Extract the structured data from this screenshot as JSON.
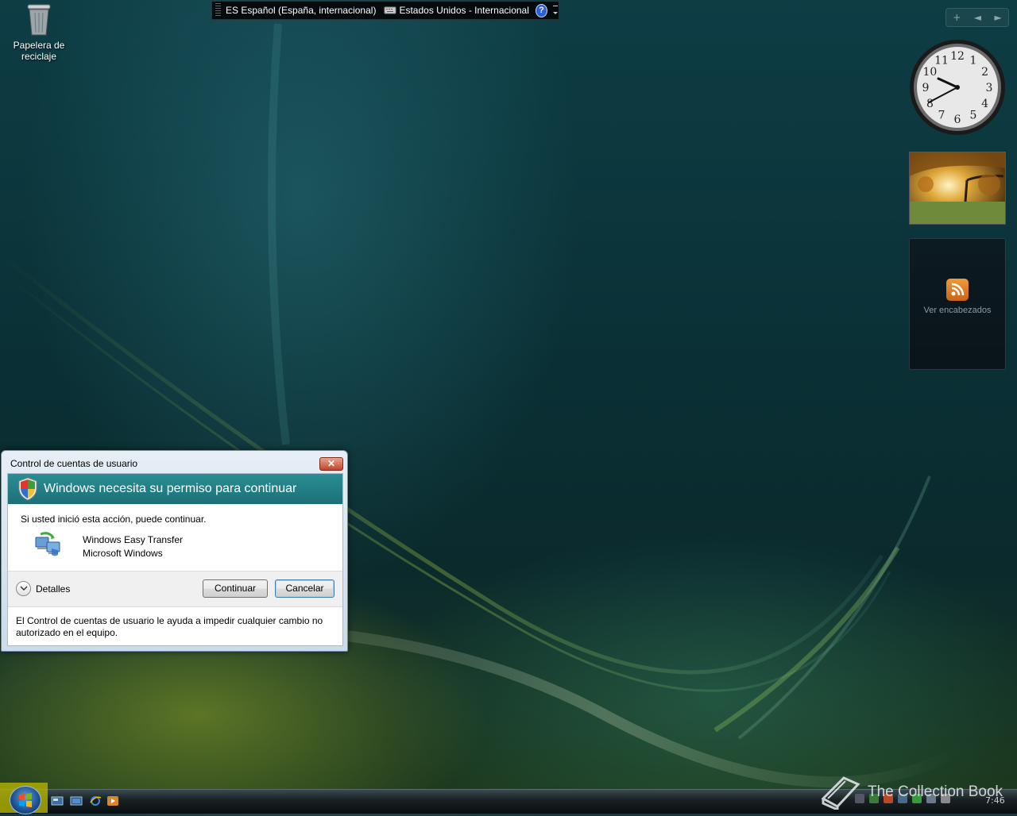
{
  "desktop": {
    "recycle_bin_label": "Papelera de reciclaje"
  },
  "language_bar": {
    "language": "ES Español (España, internacional)",
    "keyboard": "Estados Unidos - Internacional",
    "help_symbol": "?"
  },
  "sidebar": {
    "controls": [
      "+",
      "◄",
      "►"
    ],
    "clock_numbers": [
      "12",
      "1",
      "2",
      "3",
      "4",
      "5",
      "6",
      "7",
      "8",
      "9",
      "10",
      "11"
    ],
    "feed_label": "Ver encabezados"
  },
  "uac_dialog": {
    "title": "Control de cuentas de usuario",
    "close_symbol": "✕",
    "heading": "Windows necesita su permiso para continuar",
    "message": "Si usted inició esta acción, puede continuar.",
    "program_name": "Windows Easy Transfer",
    "publisher": "Microsoft Windows",
    "details_label": "Detalles",
    "continue_label": "Continuar",
    "cancel_label": "Cancelar",
    "footer": "El Control de cuentas de usuario le ayuda a impedir cualquier cambio no autorizado en el equipo.",
    "banner_color": "#1d7a80"
  },
  "taskbar": {
    "time": "7:46"
  },
  "watermark": {
    "text": "The Collection Book"
  },
  "icons": {
    "recycle_bin": "recycle-bin-icon",
    "shield": "uac-shield-icon",
    "program": "easy-transfer-icon",
    "start": "windows-orb-icon",
    "rss": "rss-icon"
  }
}
